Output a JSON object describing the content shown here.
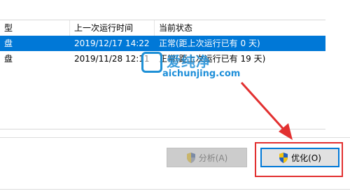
{
  "table": {
    "headers": {
      "type": "型",
      "last_run": "上一次运行时间",
      "status": "当前状态"
    },
    "rows": [
      {
        "type": "盘",
        "last_run": "2019/12/17 14:22",
        "status": "正常(距上次运行已有 0 天)",
        "selected": true
      },
      {
        "type": "盘",
        "last_run": "2019/11/28 12:11",
        "status": "正常(距上次运行已有 19 天)",
        "selected": false
      }
    ]
  },
  "buttons": {
    "analyze_label": "分析(A)",
    "optimize_label": "优化(O)"
  },
  "watermark": {
    "title": "爱纯净",
    "url": "aichunjing.com"
  },
  "colors": {
    "selection": "#0078d7",
    "annotation": "#e23030",
    "watermark": "#1e8fd9"
  },
  "icons": [
    "uac-shield-icon",
    "uac-shield-icon"
  ]
}
